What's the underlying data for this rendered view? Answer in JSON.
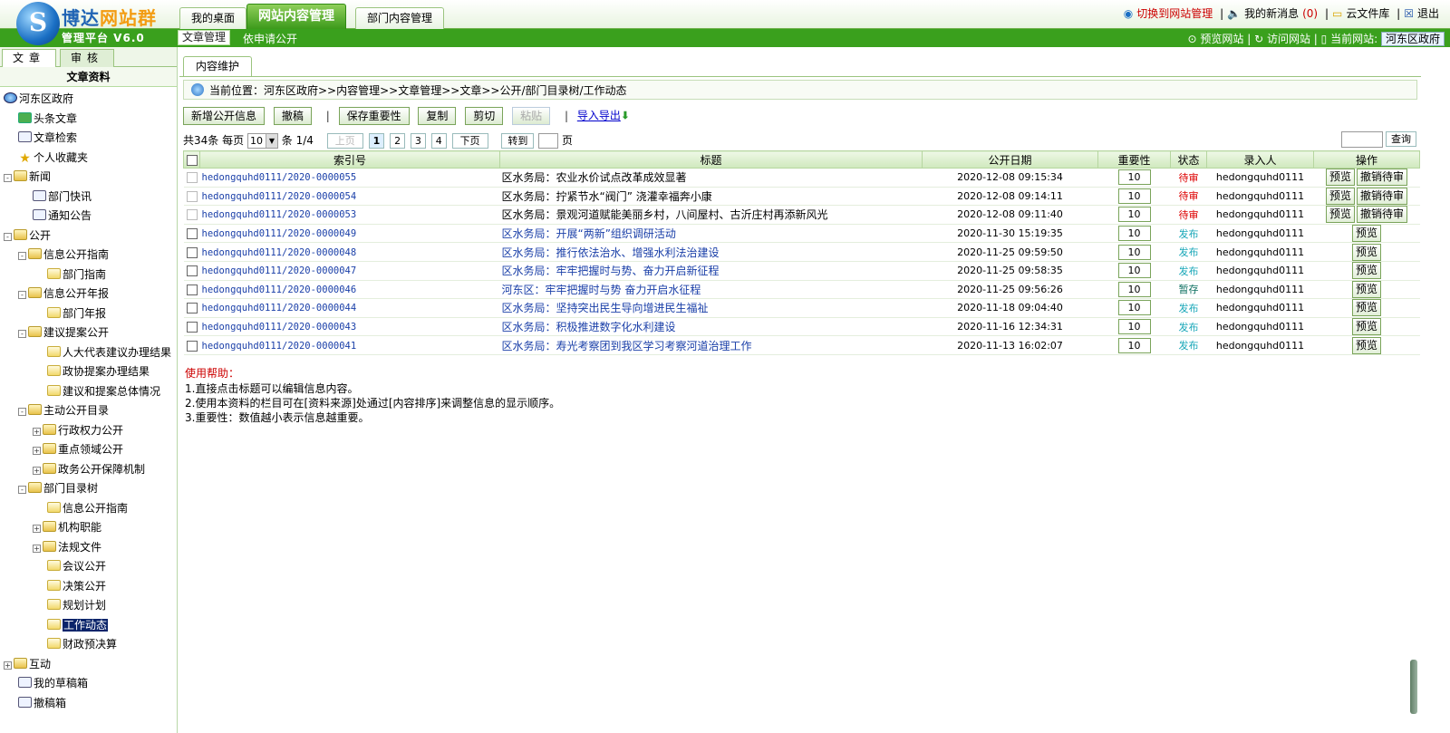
{
  "header": {
    "brand_a": "博达",
    "brand_b": "网站群",
    "platform": "管理平台  V6.0",
    "tabs": [
      {
        "label": "我的桌面",
        "active": false
      },
      {
        "label": "网站内容管理",
        "active": true
      },
      {
        "label": "部门内容管理",
        "active": false
      }
    ],
    "links": {
      "switch": "切换到网站管理",
      "messages": "我的新消息",
      "messages_count": "(0)",
      "cloud": "云文件库",
      "logout": "退出"
    }
  },
  "subbar": {
    "active": "文章管理",
    "second": "依申请公开",
    "preview": "预览网站",
    "visit": "访问网站",
    "current_label": "当前网站:",
    "current_site": "河东区政府"
  },
  "left": {
    "tab_a": "文章",
    "tab_b": "审核",
    "title": "文章资料",
    "tree": [
      {
        "label": "河东区政府",
        "icon": "globe",
        "indent": 0,
        "toggle": ""
      },
      {
        "label": "头条文章",
        "icon": "up",
        "indent": 1,
        "toggle": ""
      },
      {
        "label": "文章检索",
        "icon": "doc",
        "indent": 1,
        "toggle": ""
      },
      {
        "label": "个人收藏夹",
        "icon": "star",
        "indent": 1,
        "toggle": ""
      },
      {
        "label": "新闻",
        "icon": "folder",
        "indent": 0,
        "toggle": "-"
      },
      {
        "label": "部门快讯",
        "icon": "doc",
        "indent": 2,
        "toggle": ""
      },
      {
        "label": "通知公告",
        "icon": "doc",
        "indent": 2,
        "toggle": ""
      },
      {
        "label": "公开",
        "icon": "folder",
        "indent": 0,
        "toggle": "-"
      },
      {
        "label": "信息公开指南",
        "icon": "folder",
        "indent": 1,
        "toggle": "-"
      },
      {
        "label": "部门指南",
        "icon": "page",
        "indent": 3,
        "toggle": ""
      },
      {
        "label": "信息公开年报",
        "icon": "folder",
        "indent": 1,
        "toggle": "-"
      },
      {
        "label": "部门年报",
        "icon": "page",
        "indent": 3,
        "toggle": ""
      },
      {
        "label": "建议提案公开",
        "icon": "folder",
        "indent": 1,
        "toggle": "-"
      },
      {
        "label": "人大代表建议办理结果",
        "icon": "page",
        "indent": 3,
        "toggle": ""
      },
      {
        "label": "政协提案办理结果",
        "icon": "page",
        "indent": 3,
        "toggle": ""
      },
      {
        "label": "建议和提案总体情况",
        "icon": "page",
        "indent": 3,
        "toggle": ""
      },
      {
        "label": "主动公开目录",
        "icon": "folder",
        "indent": 1,
        "toggle": "-"
      },
      {
        "label": "行政权力公开",
        "icon": "folder",
        "indent": 2,
        "toggle": "+"
      },
      {
        "label": "重点领域公开",
        "icon": "folder",
        "indent": 2,
        "toggle": "+"
      },
      {
        "label": "政务公开保障机制",
        "icon": "folder",
        "indent": 2,
        "toggle": "+"
      },
      {
        "label": "部门目录树",
        "icon": "folder",
        "indent": 1,
        "toggle": "-"
      },
      {
        "label": "信息公开指南",
        "icon": "page",
        "indent": 3,
        "toggle": ""
      },
      {
        "label": "机构职能",
        "icon": "folder",
        "indent": 2,
        "toggle": "+"
      },
      {
        "label": "法规文件",
        "icon": "folder",
        "indent": 2,
        "toggle": "+"
      },
      {
        "label": "会议公开",
        "icon": "page",
        "indent": 3,
        "toggle": ""
      },
      {
        "label": "决策公开",
        "icon": "page",
        "indent": 3,
        "toggle": ""
      },
      {
        "label": "规划计划",
        "icon": "page",
        "indent": 3,
        "toggle": ""
      },
      {
        "label": "工作动态",
        "icon": "page",
        "indent": 3,
        "toggle": "",
        "selected": true
      },
      {
        "label": "财政预决算",
        "icon": "page",
        "indent": 3,
        "toggle": ""
      },
      {
        "label": "互动",
        "icon": "folder",
        "indent": 0,
        "toggle": "+"
      },
      {
        "label": "我的草稿箱",
        "icon": "doc",
        "indent": 1,
        "toggle": ""
      },
      {
        "label": "撤稿箱",
        "icon": "doc",
        "indent": 1,
        "toggle": ""
      }
    ]
  },
  "main": {
    "tab": "内容维护",
    "breadcrumb": "当前位置：河东区政府>>内容管理>>文章管理>>文章>>公开/部门目录树/工作动态",
    "toolbar": {
      "add": "新增公开信息",
      "withdraw": "撤稿",
      "save_importance": "保存重要性",
      "copy": "复制",
      "cut": "剪切",
      "paste": "粘贴",
      "import_export": "导入导出"
    },
    "pager": {
      "total": "共34条",
      "per_page_label": "每页",
      "per_page": "10",
      "unit": "条",
      "page_info": "1/4",
      "prev": "上页",
      "pages": [
        "1",
        "2",
        "3",
        "4"
      ],
      "next": "下页",
      "goto": "转到",
      "page_unit": "页",
      "search": "查询"
    },
    "columns": [
      "索引号",
      "标题",
      "公开日期",
      "重要性",
      "状态",
      "录入人",
      "操作"
    ],
    "rows": [
      {
        "index": "hedongquhd0111/2020-0000055",
        "title": "区水务局：农业水价试点改革成效显著",
        "date": "2020-12-08 09:15:34",
        "importance": "10",
        "status": "待审",
        "status_type": "w",
        "author": "hedongquhd0111",
        "preview": "预览",
        "cancel": "撤销待审",
        "published": false
      },
      {
        "index": "hedongquhd0111/2020-0000054",
        "title": "区水务局：拧紧节水“阀门” 浇灌幸福奔小康",
        "date": "2020-12-08 09:14:11",
        "importance": "10",
        "status": "待审",
        "status_type": "w",
        "author": "hedongquhd0111",
        "preview": "预览",
        "cancel": "撤销待审",
        "published": false
      },
      {
        "index": "hedongquhd0111/2020-0000053",
        "title": "区水务局：景观河道赋能美丽乡村，八间屋村、古沂庄村再添新风光",
        "date": "2020-12-08 09:11:40",
        "importance": "10",
        "status": "待审",
        "status_type": "w",
        "author": "hedongquhd0111",
        "preview": "预览",
        "cancel": "撤销待审",
        "published": false
      },
      {
        "index": "hedongquhd0111/2020-0000049",
        "title": "区水务局：开展“两新”组织调研活动",
        "date": "2020-11-30 15:19:35",
        "importance": "10",
        "status": "发布",
        "status_type": "p",
        "author": "hedongquhd0111",
        "preview": "预览",
        "cancel": "",
        "published": true
      },
      {
        "index": "hedongquhd0111/2020-0000048",
        "title": "区水务局：推行依法治水、增强水利法治建设",
        "date": "2020-11-25 09:59:50",
        "importance": "10",
        "status": "发布",
        "status_type": "p",
        "author": "hedongquhd0111",
        "preview": "预览",
        "cancel": "",
        "published": true
      },
      {
        "index": "hedongquhd0111/2020-0000047",
        "title": "区水务局：牢牢把握时与势、奋力开启新征程",
        "date": "2020-11-25 09:58:35",
        "importance": "10",
        "status": "发布",
        "status_type": "p",
        "author": "hedongquhd0111",
        "preview": "预览",
        "cancel": "",
        "published": true
      },
      {
        "index": "hedongquhd0111/2020-0000046",
        "title": "河东区：牢牢把握时与势 奋力开启水征程",
        "date": "2020-11-25 09:56:26",
        "importance": "10",
        "status": "暂存",
        "status_type": "z",
        "author": "hedongquhd0111",
        "preview": "预览",
        "cancel": "",
        "published": true
      },
      {
        "index": "hedongquhd0111/2020-0000044",
        "title": "区水务局：坚持突出民生导向增进民生福祉",
        "date": "2020-11-18 09:04:40",
        "importance": "10",
        "status": "发布",
        "status_type": "p",
        "author": "hedongquhd0111",
        "preview": "预览",
        "cancel": "",
        "published": true
      },
      {
        "index": "hedongquhd0111/2020-0000043",
        "title": "区水务局：积极推进数字化水利建设",
        "date": "2020-11-16 12:34:31",
        "importance": "10",
        "status": "发布",
        "status_type": "p",
        "author": "hedongquhd0111",
        "preview": "预览",
        "cancel": "",
        "published": true
      },
      {
        "index": "hedongquhd0111/2020-0000041",
        "title": "区水务局：寿光考察团到我区学习考察河道治理工作",
        "date": "2020-11-13 16:02:07",
        "importance": "10",
        "status": "发布",
        "status_type": "p",
        "author": "hedongquhd0111",
        "preview": "预览",
        "cancel": "",
        "published": true
      }
    ],
    "help": {
      "title": "使用帮助：",
      "lines": [
        "1.直接点击标题可以编辑信息内容。",
        "2.使用本资料的栏目可在[资料来源]处通过[内容排序]来调整信息的显示顺序。",
        "3.重要性：数值越小表示信息越重要。"
      ]
    }
  }
}
